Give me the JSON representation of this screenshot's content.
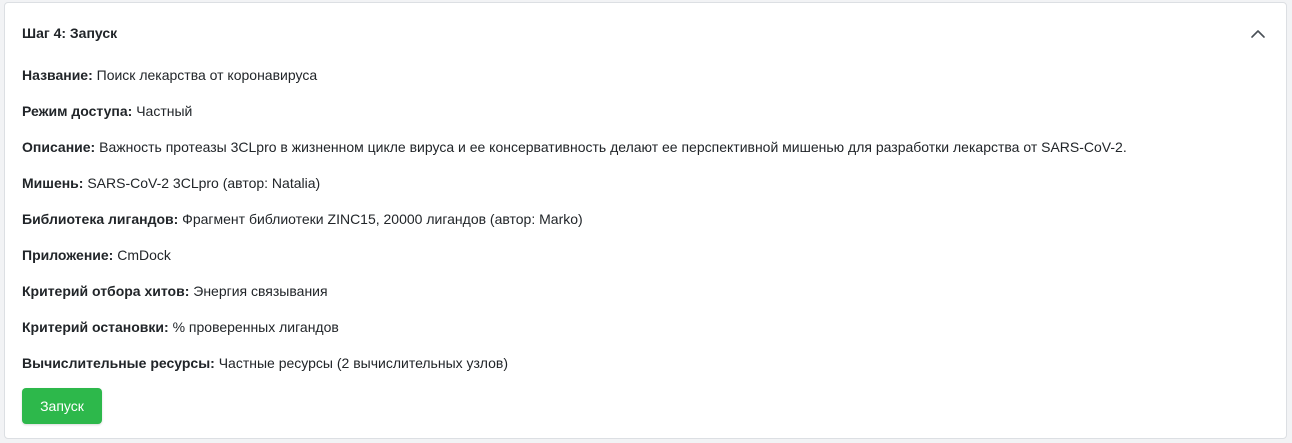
{
  "header": {
    "title": "Шаг 4: Запуск",
    "collapse_icon": "chevron-up-icon"
  },
  "details": [
    {
      "label": "Название:",
      "value": "Поиск лекарства от коронавируса"
    },
    {
      "label": "Режим доступа:",
      "value": "Частный"
    },
    {
      "label": "Описание:",
      "value": "Важность протеазы 3CLpro в жизненном цикле вируса и ее консервативность делают ее перспективной мишенью для разработки лекарства от SARS-CoV-2."
    },
    {
      "label": "Мишень:",
      "value": "SARS-CoV-2 3CLpro (автор: Natalia)"
    },
    {
      "label": "Библиотека лигандов:",
      "value": "Фрагмент библиотеки ZINC15, 20000 лигандов (автор: Marko)"
    },
    {
      "label": "Приложение:",
      "value": "CmDock"
    },
    {
      "label": "Критерий отбора хитов:",
      "value": "Энергия связывания"
    },
    {
      "label": "Критерий остановки:",
      "value": "% проверенных лигандов"
    },
    {
      "label": "Вычислительные ресурсы:",
      "value": "Частные ресурсы (2 вычислительных узлов)"
    }
  ],
  "actions": {
    "launch_label": "Запуск"
  },
  "colors": {
    "primary_button": "#2db84b",
    "text": "#212529"
  }
}
